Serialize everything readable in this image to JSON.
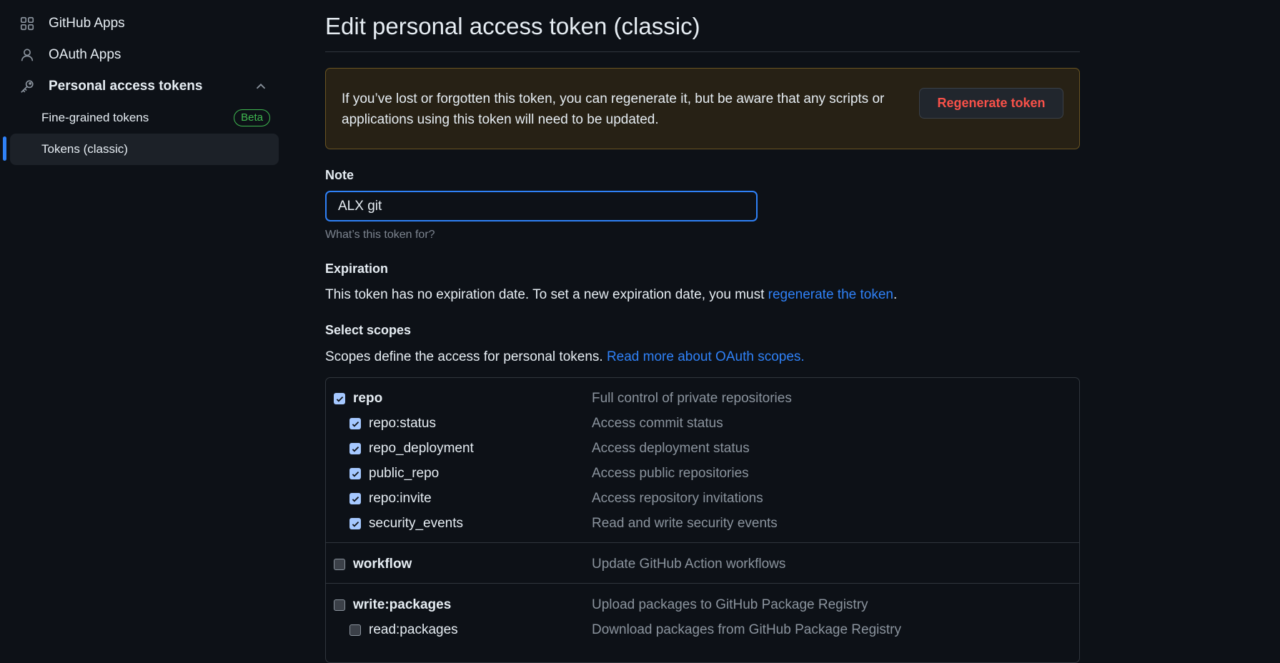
{
  "sidebar": {
    "github_apps": "GitHub Apps",
    "oauth_apps": "OAuth Apps",
    "pat": "Personal access tokens",
    "fine_grained": "Fine-grained tokens",
    "beta": "Beta",
    "classic": "Tokens (classic)"
  },
  "main": {
    "title": "Edit personal access token (classic)",
    "warning_text": "If you’ve lost or forgotten this token, you can regenerate it, but be aware that any scripts or applications using this token will need to be updated.",
    "regenerate_button": "Regenerate token",
    "note_label": "Note",
    "note_value": "ALX git",
    "note_hint": "What’s this token for?",
    "expiration_label": "Expiration",
    "expiration_text": "This token has no expiration date. To set a new expiration date, you must ",
    "expiration_link": "regenerate the token",
    "expiration_end": ".",
    "scopes_label": "Select scopes",
    "scopes_text": "Scopes define the access for personal tokens. ",
    "scopes_link": "Read more about OAuth scopes.",
    "scopes": [
      {
        "name": "repo",
        "desc": "Full control of private repositories",
        "checked": true
      },
      {
        "name": "repo:status",
        "desc": "Access commit status",
        "checked": true
      },
      {
        "name": "repo_deployment",
        "desc": "Access deployment status",
        "checked": true
      },
      {
        "name": "public_repo",
        "desc": "Access public repositories",
        "checked": true
      },
      {
        "name": "repo:invite",
        "desc": "Access repository invitations",
        "checked": true
      },
      {
        "name": "security_events",
        "desc": "Read and write security events",
        "checked": true
      },
      {
        "name": "workflow",
        "desc": "Update GitHub Action workflows",
        "checked": false
      },
      {
        "name": "write:packages",
        "desc": "Upload packages to GitHub Package Registry",
        "checked": false
      },
      {
        "name": "read:packages",
        "desc": "Download packages from GitHub Package Registry",
        "checked": false
      }
    ]
  },
  "colors": {
    "accent": "#2f81f7",
    "danger": "#f85149",
    "beta": "#3fb950",
    "background": "#0d1117"
  }
}
